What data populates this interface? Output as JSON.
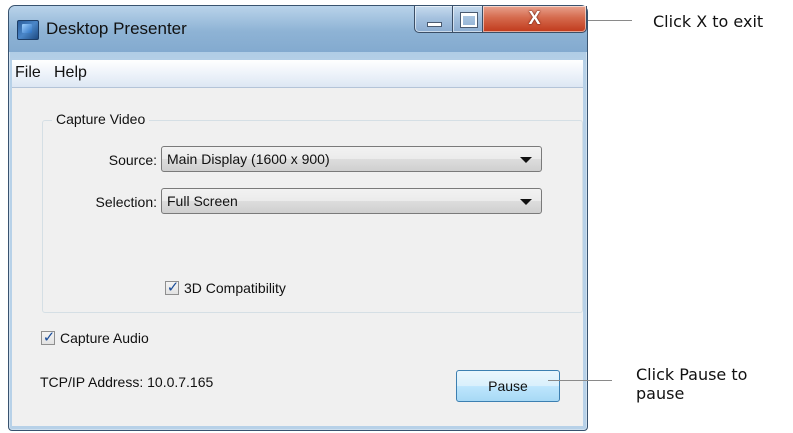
{
  "window": {
    "title": "Desktop Presenter",
    "close_glyph": "X",
    "minimize_icon": "minimize-icon",
    "maximize_icon": "maximize-icon"
  },
  "menu": {
    "items": [
      {
        "label": "File"
      },
      {
        "label": "Help"
      }
    ]
  },
  "capture_video": {
    "group_label": "Capture Video",
    "source_label": "Source:",
    "source_value": "Main Display (1600 x 900)",
    "selection_label": "Selection:",
    "selection_value": "Full Screen",
    "compat_label": "3D Compatibility",
    "compat_checked": true
  },
  "capture_audio": {
    "label": "Capture Audio",
    "checked": true
  },
  "network": {
    "ip_text": "TCP/IP Address: 10.0.7.165"
  },
  "actions": {
    "pause_label": "Pause"
  },
  "annotations": {
    "exit_note": "Click X to exit",
    "pause_note_line1": "Click Pause to",
    "pause_note_line2": "pause"
  },
  "colors": {
    "close_button": "#c0391b",
    "pause_button_border": "#3c7fb1",
    "checkmark": "#1c4e9a"
  }
}
